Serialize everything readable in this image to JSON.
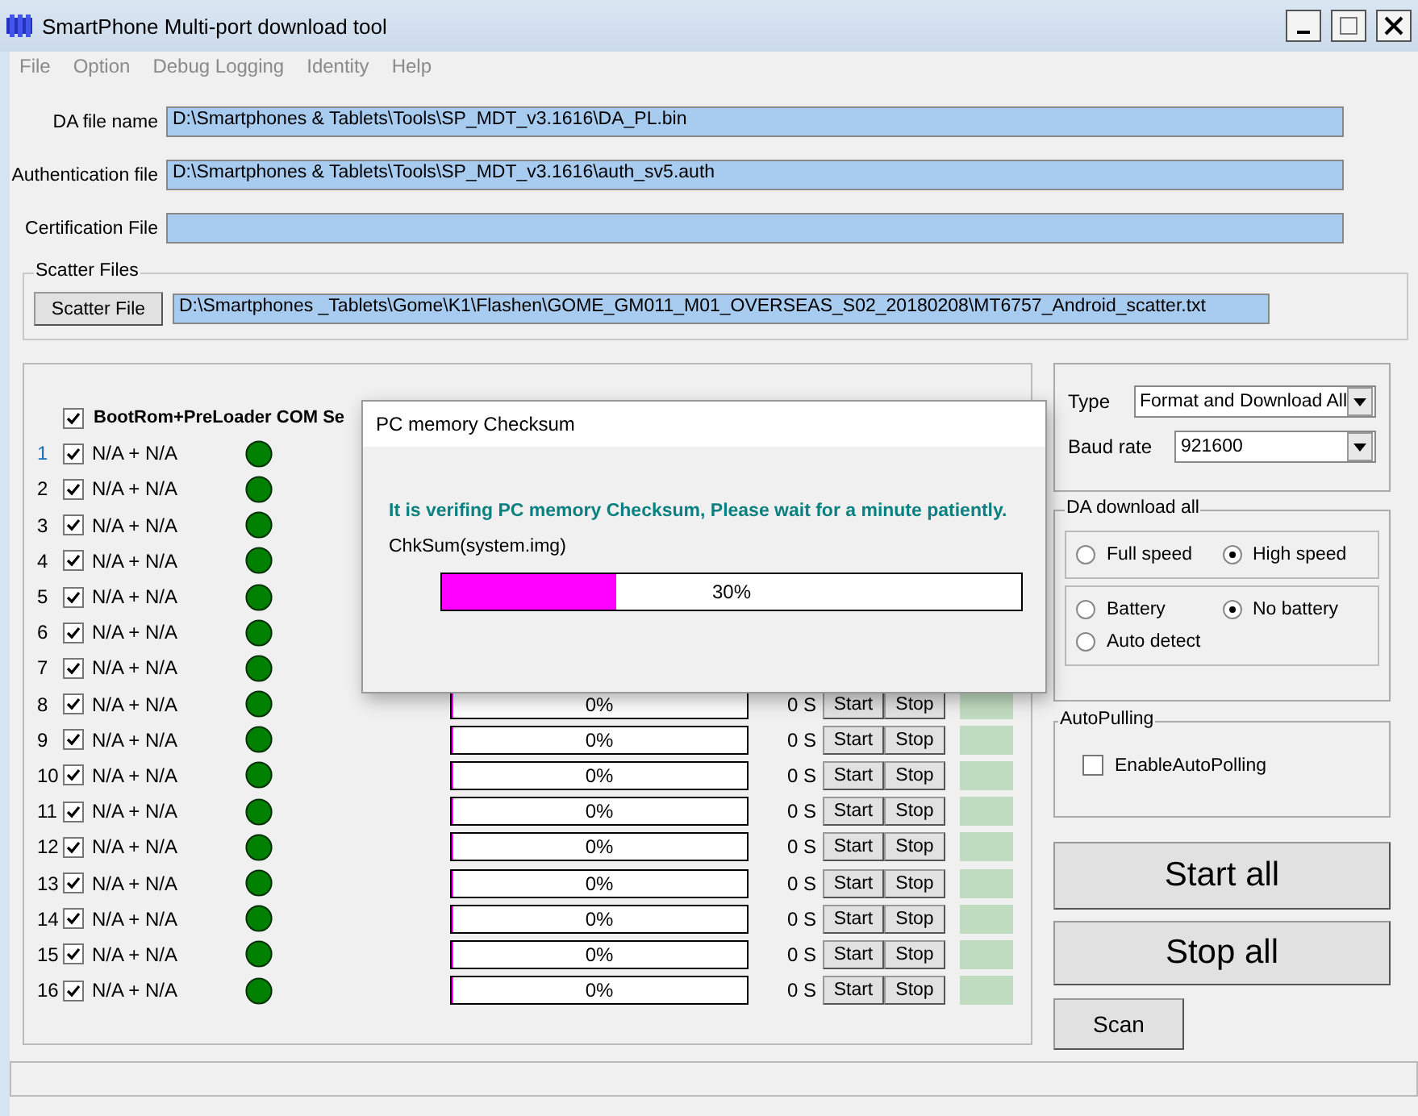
{
  "window": {
    "title": "SmartPhone Multi-port download tool"
  },
  "menu": [
    "File",
    "Option",
    "Debug Logging",
    "Identity",
    "Help"
  ],
  "fields": [
    {
      "label": "DA file name",
      "value": "D:\\Smartphones & Tablets\\Tools\\SP_MDT_v3.1616\\DA_PL.bin"
    },
    {
      "label": "Authentication file",
      "value": "D:\\Smartphones & Tablets\\Tools\\SP_MDT_v3.1616\\auth_sv5.auth"
    },
    {
      "label": "Certification File"
    }
  ],
  "scatter": {
    "group_label": "Scatter Files",
    "button": "Scatter File",
    "value": "D:\\Smartphones _Tablets\\Gome\\K1\\Flashen\\GOME_GM011_M01_OVERSEAS_S02_20180208\\MT6757_Android_scatter.txt"
  },
  "ports": {
    "header": {
      "checked": true,
      "label": "BootRom+PreLoader COM Se"
    },
    "rows": [
      {
        "number": "1",
        "checked": true,
        "label": "N/A + N/A"
      },
      {
        "number": "2",
        "checked": true,
        "label": "N/A + N/A"
      },
      {
        "number": "3",
        "checked": true,
        "label": "N/A + N/A"
      },
      {
        "number": "4",
        "checked": true,
        "label": "N/A + N/A"
      },
      {
        "number": "5",
        "checked": true,
        "label": "N/A + N/A"
      },
      {
        "number": "6",
        "checked": true,
        "label": "N/A + N/A"
      },
      {
        "number": "7",
        "checked": true,
        "label": "N/A + N/A"
      },
      {
        "number": "8",
        "checked": true,
        "label": "N/A + N/A",
        "progress": {
          "level": 0,
          "text": "0%"
        },
        "time": "0 S",
        "start": "Start",
        "stop": "Stop"
      },
      {
        "number": "9",
        "checked": true,
        "label": "N/A + N/A",
        "progress": {
          "level": 0,
          "text": "0%"
        },
        "time": "0 S",
        "start": "Start",
        "stop": "Stop"
      },
      {
        "number": "10",
        "checked": true,
        "label": "N/A + N/A",
        "progress": {
          "level": 0,
          "text": "0%"
        },
        "time": "0 S",
        "start": "Start",
        "stop": "Stop"
      },
      {
        "number": "11",
        "checked": true,
        "label": "N/A + N/A",
        "progress": {
          "level": 0,
          "text": "0%"
        },
        "time": "0 S",
        "start": "Start",
        "stop": "Stop"
      },
      {
        "number": "12",
        "checked": true,
        "label": "N/A + N/A",
        "progress": {
          "level": 0,
          "text": "0%"
        },
        "time": "0 S",
        "start": "Start",
        "stop": "Stop"
      },
      {
        "number": "13",
        "checked": true,
        "label": "N/A + N/A",
        "progress": {
          "level": 0,
          "text": "0%"
        },
        "time": "0 S",
        "start": "Start",
        "stop": "Stop"
      },
      {
        "number": "14",
        "checked": true,
        "label": "N/A + N/A",
        "progress": {
          "level": 0,
          "text": "0%"
        },
        "time": "0 S",
        "start": "Start",
        "stop": "Stop"
      },
      {
        "number": "15",
        "checked": true,
        "label": "N/A + N/A",
        "progress": {
          "level": 0,
          "text": "0%"
        },
        "time": "0 S",
        "start": "Start",
        "stop": "Stop"
      },
      {
        "number": "16",
        "checked": true,
        "label": "N/A + N/A",
        "progress": {
          "level": 0,
          "text": "0%"
        },
        "time": "0 S",
        "start": "Start",
        "stop": "Stop"
      }
    ]
  },
  "settings": {
    "type": {
      "label": "Type",
      "value": "Format and Download All"
    },
    "baud": {
      "label": "Baud rate",
      "value": "921600"
    }
  },
  "da_download": {
    "title": "DA download all",
    "speed": [
      {
        "label": "Full speed",
        "selected": false
      },
      {
        "label": "High speed",
        "selected": true
      }
    ],
    "battery": [
      {
        "label": "Battery",
        "selected": false
      },
      {
        "label": "No battery",
        "selected": true
      },
      {
        "label": "Auto detect",
        "selected": false
      }
    ]
  },
  "auto_polling": {
    "title": "AutoPulling",
    "label": "EnableAutoPolling",
    "checked": false
  },
  "buttons": {
    "start_all": "Start all",
    "stop_all": "Stop all",
    "scan": "Scan"
  },
  "dialog": {
    "title": "PC memory Checksum",
    "message": "It is verifing PC memory Checksum, Please wait for a minute  patiently.",
    "item": "ChkSum(system.img)",
    "progress": {
      "level": 0.3,
      "text": "30%"
    }
  }
}
